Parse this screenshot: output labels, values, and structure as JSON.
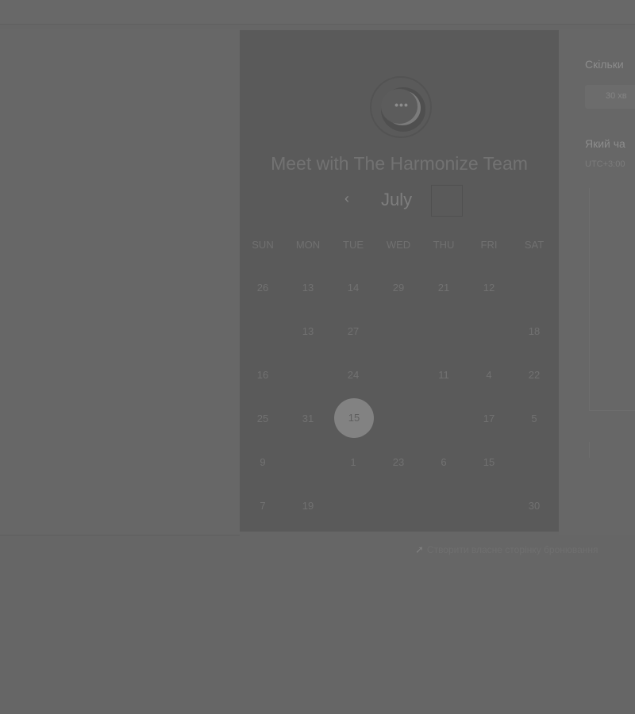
{
  "card": {
    "title": "Meet with The Harmonize Team",
    "month": "July",
    "prev_icon": "chevron-left-icon",
    "next_icon": "chevron-right-icon",
    "logo_icon": "chat-bubble-icon",
    "logo_dots": "•••",
    "weekdays": [
      "SUN",
      "MON",
      "TUE",
      "WED",
      "THU",
      "FRI",
      "SAT"
    ],
    "days": [
      [
        "26",
        "13",
        "14",
        "29",
        "21",
        "12",
        ""
      ],
      [
        "",
        "13",
        "27",
        "",
        "",
        "",
        "18"
      ],
      [
        "16",
        "",
        "24",
        "",
        "11",
        "4",
        "22"
      ],
      [
        "25",
        "31",
        "15",
        "",
        "",
        "17",
        "5"
      ],
      [
        "9",
        "",
        "1",
        "23",
        "6",
        "15",
        ""
      ],
      [
        "7",
        "19",
        "",
        "",
        "",
        "",
        "30"
      ]
    ],
    "selected_day": "15"
  },
  "side": {
    "question_1": "Скільки",
    "duration_option": "30 хв",
    "question_2": "Який ча",
    "timezone_hint": "UTC+3:00"
  },
  "footer": {
    "link_text": "Створити власне сторінку бронювання",
    "icon": "arrow-icon"
  },
  "colors": {
    "background": "#666666",
    "card": "#5a5a5a",
    "selected": "#828282"
  }
}
